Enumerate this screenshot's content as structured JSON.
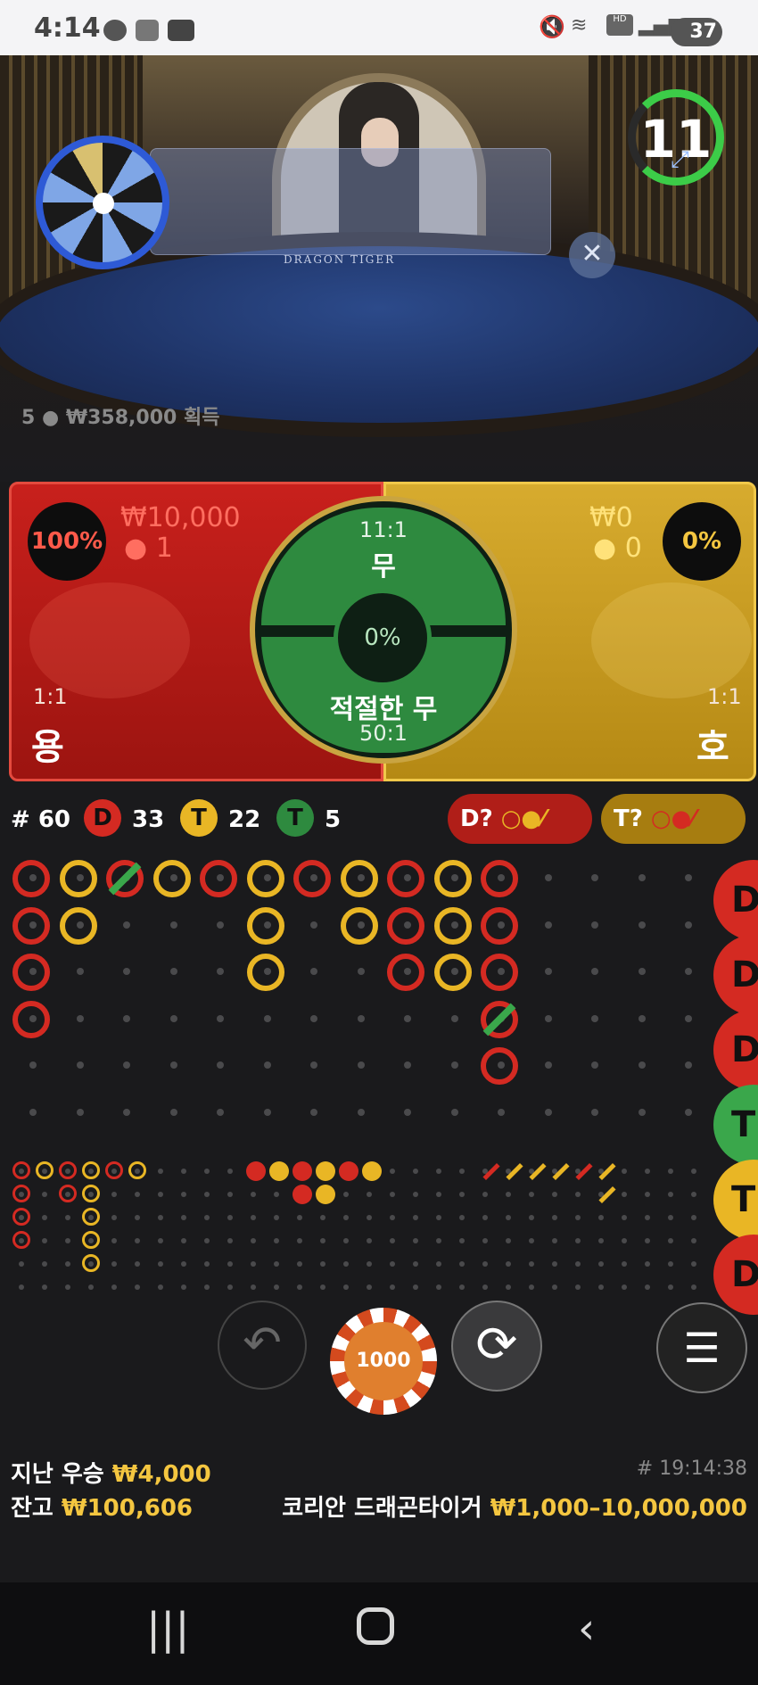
{
  "status_bar": {
    "time": "4:14",
    "battery": "37"
  },
  "video": {
    "table_text": "DRAGON   TIGER",
    "timer": "11",
    "winners_count": "5",
    "winners_amount": "₩358,000",
    "winners_suffix": "획득"
  },
  "bet": {
    "dragon": {
      "percent": "100%",
      "amount": "₩10,000",
      "players": "1",
      "odds": "1:1",
      "label": "용"
    },
    "tiger": {
      "percent": "0%",
      "amount": "₩0",
      "players": "0",
      "odds": "1:1",
      "label": "호"
    },
    "tie": {
      "odds": "11:1",
      "label": "무",
      "percent": "0%"
    },
    "suited_tie": {
      "label": "적절한 무",
      "odds": "50:1"
    }
  },
  "stats": {
    "round": "# 60",
    "dragon_letter": "D",
    "dragon_count": "33",
    "tiger_letter": "T",
    "tiger_count": "22",
    "tie_letter": "T",
    "tie_count": "5",
    "dragon_predict": "D?",
    "tiger_predict": "T?"
  },
  "big_road": [
    [
      "D",
      "D",
      "D",
      "D"
    ],
    [
      "T",
      "T"
    ],
    [
      "D*"
    ],
    [
      "T"
    ],
    [
      "D"
    ],
    [
      "T",
      "T",
      "T"
    ],
    [
      "D"
    ],
    [
      "T",
      "T"
    ],
    [
      "D",
      "D",
      "D"
    ],
    [
      "T",
      "T",
      "T"
    ],
    [
      "D",
      "D",
      "D",
      "D*",
      "D"
    ]
  ],
  "side_road_labels": [
    "D",
    "D",
    "D",
    "T",
    "T",
    "D"
  ],
  "chip": {
    "value": "1000"
  },
  "footer": {
    "last_win_label": "지난 우승",
    "last_win_value": "₩4,000",
    "balance_label": "잔고",
    "balance_value": "₩100,606",
    "game_id": "# 19:14:38",
    "table_name": "코리안 드래곤타이거",
    "limits": "₩1,000–10,000,000"
  },
  "colors": {
    "dragon": "#d42a22",
    "tiger": "#e9b625",
    "tie": "#3aa74b"
  }
}
